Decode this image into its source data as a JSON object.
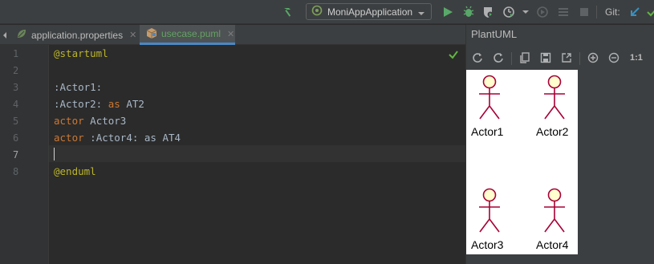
{
  "toolbar": {
    "run_config": "MoniAppApplication",
    "git_label": "Git:",
    "icons": [
      "hammer-icon",
      "run-config-icon",
      "run-icon",
      "debug-icon",
      "coverage-icon",
      "profile-icon",
      "attach-icon",
      "build-icon",
      "stop-icon",
      "git-update-icon"
    ]
  },
  "tabs": [
    {
      "label": "application.properties",
      "icon": "spring-leaf-icon",
      "active": false
    },
    {
      "label": "usecase.puml",
      "icon": "puml-file-icon",
      "active": true
    }
  ],
  "editor": {
    "line_numbers": [
      "1",
      "2",
      "3",
      "4",
      "5",
      "6",
      "7",
      "8"
    ],
    "current_line": "7",
    "lines": [
      {
        "tokens": [
          {
            "t": "@startuml",
            "c": "ann"
          }
        ]
      },
      {
        "tokens": []
      },
      {
        "tokens": [
          {
            "t": ":Actor1:",
            "c": "plain"
          }
        ]
      },
      {
        "tokens": [
          {
            "t": ":Actor2: ",
            "c": "plain"
          },
          {
            "t": "as",
            "c": "kw"
          },
          {
            "t": " AT2",
            "c": "plain"
          }
        ]
      },
      {
        "tokens": [
          {
            "t": "actor",
            "c": "kw"
          },
          {
            "t": " Actor3",
            "c": "plain"
          }
        ]
      },
      {
        "tokens": [
          {
            "t": "actor",
            "c": "kw"
          },
          {
            "t": " :Actor4: as AT4",
            "c": "plain"
          }
        ]
      },
      {
        "tokens": []
      },
      {
        "tokens": [
          {
            "t": "@enduml",
            "c": "ann"
          }
        ]
      }
    ]
  },
  "plantuml": {
    "title": "PlantUML",
    "zoom_label": "1:1",
    "actors": [
      "Actor1",
      "Actor2",
      "Actor3",
      "Actor4"
    ]
  },
  "colors": {
    "accent_tab": "#4a88c7",
    "annotation": "#bbb529",
    "keyword": "#cc7832",
    "actor_fill": "#fefece",
    "actor_stroke": "#a80036"
  }
}
